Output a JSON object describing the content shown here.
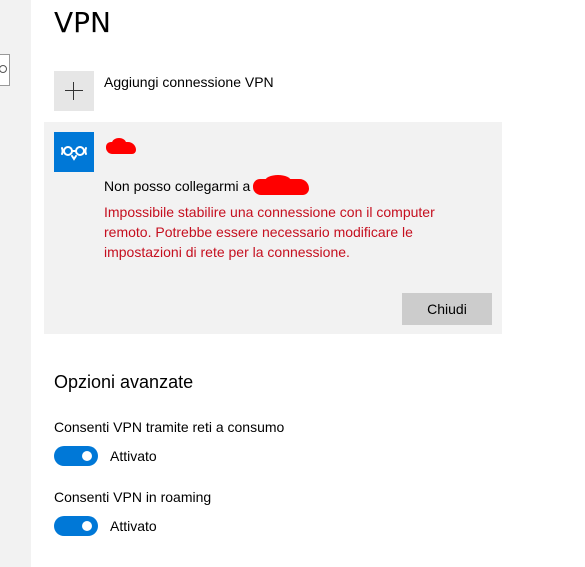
{
  "page": {
    "title": "VPN"
  },
  "add_connection": {
    "label": "Aggiungi connessione VPN"
  },
  "vpn_connection": {
    "status_text": "Non posso collegarmi a",
    "error_message": "Impossibile stabilire una connessione con il computer remoto. Potrebbe essere necessario modificare le impostazioni di rete per la connessione.",
    "close_label": "Chiudi",
    "icon_color": "#0078d7",
    "error_color": "#c50f1f",
    "redaction_color": "#ff0000"
  },
  "advanced": {
    "title": "Opzioni avanzate",
    "options": [
      {
        "label": "Consenti VPN tramite reti a consumo",
        "state_label": "Attivato",
        "on": true
      },
      {
        "label": "Consenti VPN in roaming",
        "state_label": "Attivato",
        "on": true
      }
    ]
  },
  "colors": {
    "accent": "#0078d7",
    "card_bg": "#f2f2f2",
    "button_bg": "#cccccc"
  }
}
